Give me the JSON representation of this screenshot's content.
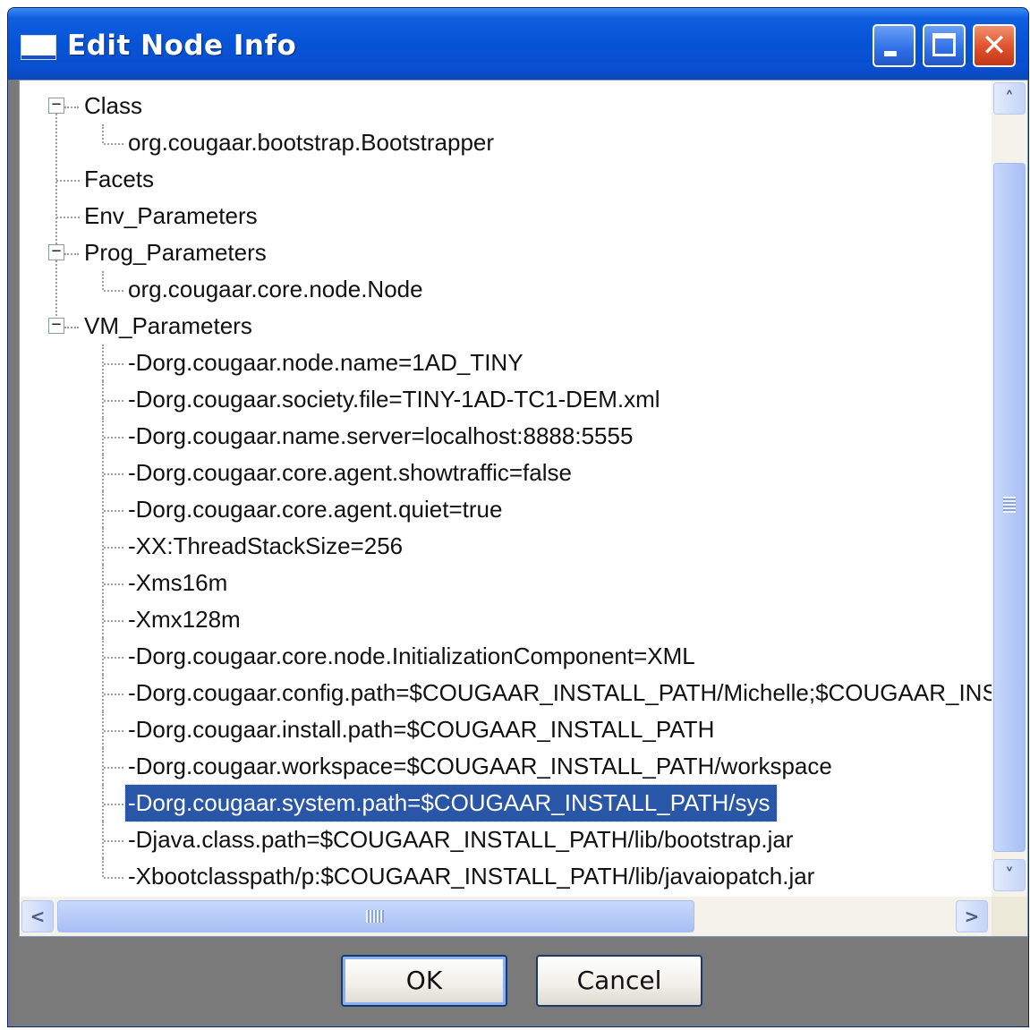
{
  "window": {
    "title": "Edit Node Info",
    "controls": {
      "minimize_icon": "minimize-icon",
      "maximize_icon": "maximize-icon",
      "close_icon": "close-icon",
      "close_glyph": "✕"
    }
  },
  "tree": {
    "nodes": [
      {
        "label": "Class",
        "depth": 0,
        "expandable": true,
        "expanded": true
      },
      {
        "label": "org.cougaar.bootstrap.Bootstrapper",
        "depth": 1
      },
      {
        "label": "Facets",
        "depth": 0
      },
      {
        "label": "Env_Parameters",
        "depth": 0
      },
      {
        "label": "Prog_Parameters",
        "depth": 0,
        "expandable": true,
        "expanded": true
      },
      {
        "label": "org.cougaar.core.node.Node",
        "depth": 1
      },
      {
        "label": "VM_Parameters",
        "depth": 0,
        "expandable": true,
        "expanded": true
      },
      {
        "label": "-Dorg.cougaar.node.name=1AD_TINY",
        "depth": 1
      },
      {
        "label": "-Dorg.cougaar.society.file=TINY-1AD-TC1-DEM.xml",
        "depth": 1
      },
      {
        "label": "-Dorg.cougaar.name.server=localhost:8888:5555",
        "depth": 1
      },
      {
        "label": "-Dorg.cougaar.core.agent.showtraffic=false",
        "depth": 1
      },
      {
        "label": "-Dorg.cougaar.core.agent.quiet=true",
        "depth": 1
      },
      {
        "label": "-XX:ThreadStackSize=256",
        "depth": 1
      },
      {
        "label": "-Xms16m",
        "depth": 1
      },
      {
        "label": "-Xmx128m",
        "depth": 1
      },
      {
        "label": "-Dorg.cougaar.core.node.InitializationComponent=XML",
        "depth": 1
      },
      {
        "label": "-Dorg.cougaar.config.path=$COUGAAR_INSTALL_PATH/Michelle;$COUGAAR_INSTALL_PATH/configs/common",
        "depth": 1
      },
      {
        "label": "-Dorg.cougaar.install.path=$COUGAAR_INSTALL_PATH",
        "depth": 1
      },
      {
        "label": "-Dorg.cougaar.workspace=$COUGAAR_INSTALL_PATH/workspace",
        "depth": 1
      },
      {
        "label": "-Dorg.cougaar.system.path=$COUGAAR_INSTALL_PATH/sys",
        "depth": 1,
        "selected": true
      },
      {
        "label": "-Djava.class.path=$COUGAAR_INSTALL_PATH/lib/bootstrap.jar",
        "depth": 1
      },
      {
        "label": "-Xbootclasspath/p:$COUGAAR_INSTALL_PATH/lib/javaiopatch.jar",
        "depth": 1
      }
    ],
    "expanded_glyph": "−"
  },
  "scrollbars": {
    "up_glyph": "˄",
    "down_glyph": "˅",
    "left_glyph": "<",
    "right_glyph": ">"
  },
  "buttons": {
    "ok": "OK",
    "cancel": "Cancel"
  },
  "colors": {
    "titlebar": "#0753d6",
    "selection": "#2a56a8",
    "frame": "#7a7a7a"
  }
}
